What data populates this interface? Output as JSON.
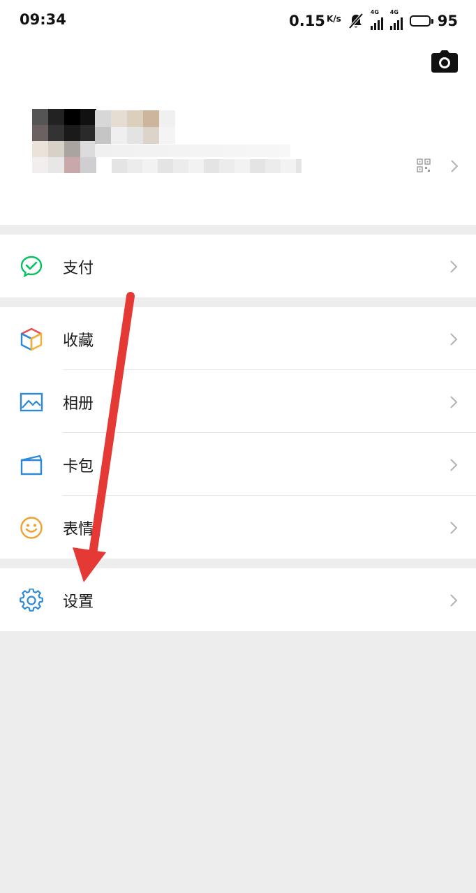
{
  "status_bar": {
    "time": "09:34",
    "net_speed": "0.15",
    "net_unit": "K/s",
    "signal1_label": "4G",
    "signal2_label": "4G",
    "battery": "95",
    "icons": [
      "mute-bell-icon",
      "signal-icon",
      "battery-icon"
    ]
  },
  "profile": {
    "camera_icon": "camera-icon",
    "qr_icon": "qr-code-icon"
  },
  "menu": {
    "pay": {
      "label": "支付",
      "icon": "wechat-pay-icon",
      "color": "#07c160"
    },
    "favorites": {
      "label": "收藏",
      "icon": "cube-icon"
    },
    "album": {
      "label": "相册",
      "icon": "picture-icon",
      "color": "#2b88d8"
    },
    "cards": {
      "label": "卡包",
      "icon": "card-wallet-icon",
      "color": "#2b88d8"
    },
    "stickers": {
      "label": "表情",
      "icon": "smiley-icon",
      "color": "#f0a030"
    },
    "settings": {
      "label": "设置",
      "icon": "gear-icon",
      "color": "#2b88d8"
    }
  },
  "annotation": {
    "arrow_color": "#e53935"
  }
}
